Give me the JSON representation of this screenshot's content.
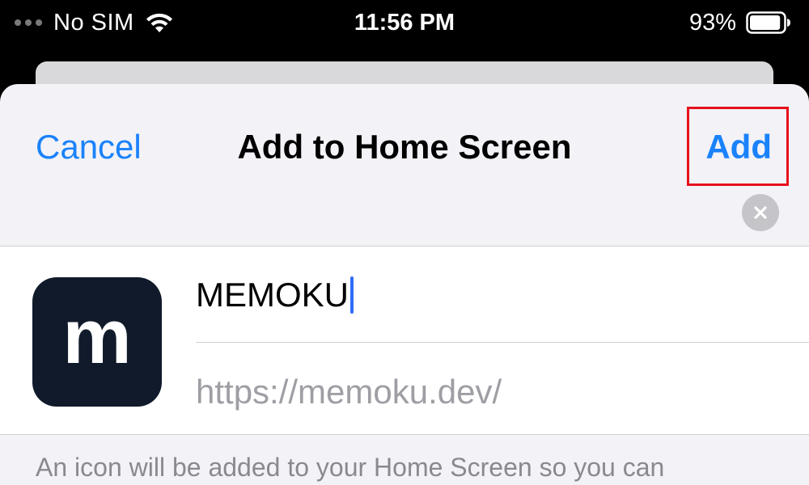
{
  "status_bar": {
    "carrier": "No SIM",
    "time": "11:56 PM",
    "battery_percent": "93%",
    "battery_level": 0.93,
    "icons": [
      "signal-dots-icon",
      "wifi-icon",
      "battery-icon"
    ]
  },
  "nav": {
    "cancel_label": "Cancel",
    "title": "Add to Home Screen",
    "add_label": "Add"
  },
  "form": {
    "app_icon_letter": "m",
    "name_value": "MEMOKU",
    "url": "https://memoku.dev/",
    "clear_icon": "clear-circle-icon"
  },
  "footer": {
    "text": "An icon will be added to your Home Screen so you can"
  },
  "colors": {
    "accent": "#1a82fb",
    "highlight_border": "#e8101c",
    "app_icon_bg": "#101a2b",
    "caret": "#2f6cf6"
  }
}
